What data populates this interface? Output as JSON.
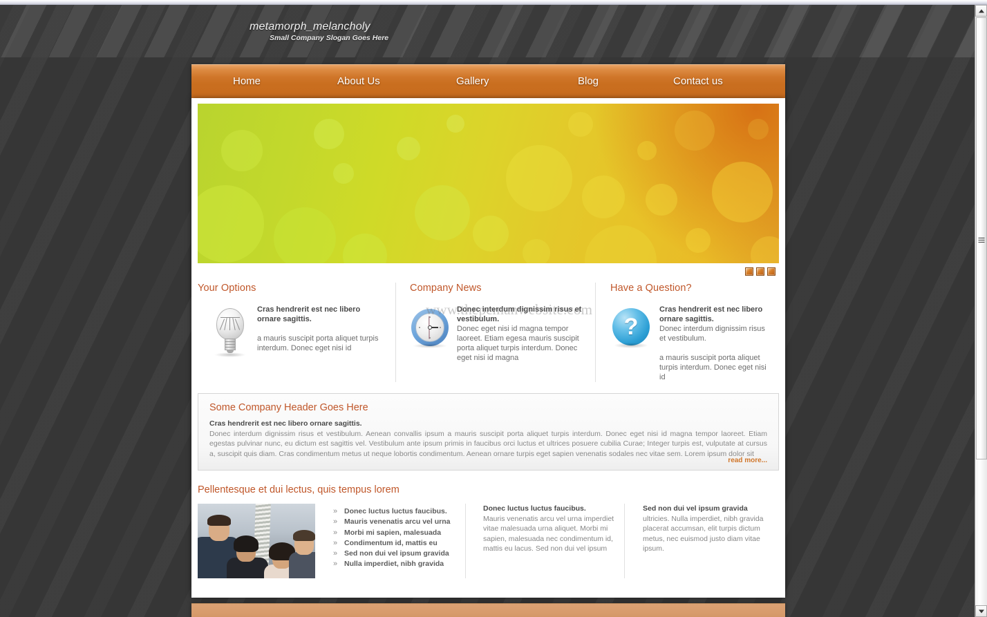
{
  "brand": {
    "logo": "metamorph_melancholy",
    "slogan": "Small Company Slogan Goes Here"
  },
  "nav": {
    "items": [
      {
        "label": "Home"
      },
      {
        "label": "About Us"
      },
      {
        "label": "Gallery"
      },
      {
        "label": "Blog"
      },
      {
        "label": "Contact us"
      }
    ]
  },
  "slider": {
    "dots": [
      "1",
      "2",
      "3"
    ]
  },
  "watermark": "www.thepcmanwebsite.com",
  "features": [
    {
      "heading": "Your Options",
      "icon": "lightbulb-icon",
      "lead": "Cras hendrerit est nec libero ornare sagittis.",
      "body": "",
      "body2": "a mauris suscipit porta aliquet turpis interdum. Donec eget nisi id"
    },
    {
      "heading": "Company News",
      "icon": "clock-icon",
      "lead": "Donec interdum dignissim risus et vestibulum.",
      "body": "Donec eget nisi id magna tempor laoreet. Etiam egesa mauris suscipit porta aliquet turpis interdum. Donec eget nisi id magna",
      "body2": ""
    },
    {
      "heading": "Have a Question?",
      "icon": "question-mark-icon",
      "lead": "Cras hendrerit est nec libero ornare sagittis.",
      "body": "Donec interdum dignissim risus et vestibulum.",
      "body2": "a mauris suscipit porta aliquet turpis interdum. Donec eget nisi id"
    }
  ],
  "panel": {
    "heading": "Some Company Header Goes Here",
    "lead": "Cras hendrerit est nec libero ornare sagittis.",
    "body": "Donec interdum dignissim risus et vestibulum. Aenean convallis ipsum a mauris suscipit porta aliquet turpis interdum. Donec eget nisi id magna tempor laoreet. Etiam egestas pulvinar nunc, eu dictum est sagittis vel. Vestibulum ante ipsum primis in faucibus orci luctus et ultrices posuere cubilia Curae; Integer turpis est, vulputate at cursus a, suscipit quis diam. Cras condimentum metus ut neque lobortis condimentum. Aenean ornare turpis eget sapien venenatis sodales nec vitae sem. Lorem ipsum dolor sit",
    "read_more": "read more..."
  },
  "bottom": {
    "heading": "Pellentesque et dui lectus, quis tempus lorem",
    "bullets": [
      "Donec luctus luctus faucibus.",
      "Mauris venenatis arcu vel urna",
      "Morbi mi sapien, malesuada",
      "Condimentum id, mattis eu",
      "Sed non dui vel ipsum gravida",
      "Nulla imperdiet, nibh gravida"
    ],
    "col2": {
      "lead": "Donec luctus luctus faucibus.",
      "body": "Mauris venenatis arcu vel urna imperdiet vitae malesuada urna aliquet. Morbi mi sapien, malesuada nec condimentum id, mattis eu lacus. Sed non dui vel ipsum"
    },
    "col3": {
      "lead": "Sed non dui vel ipsum gravida",
      "body": "ultricies. Nulla imperdiet, nibh gravida placerat accumsan, elit turpis dictum metus, nec euismod justo diam vitae ipsum."
    }
  },
  "colors": {
    "accent_orange": "#c0572a",
    "nav_orange": "#c96e1f",
    "link_orange": "#d0762a",
    "page_background": "#363636",
    "banner_green": "#b9d42e",
    "banner_yellow": "#e8c228"
  }
}
